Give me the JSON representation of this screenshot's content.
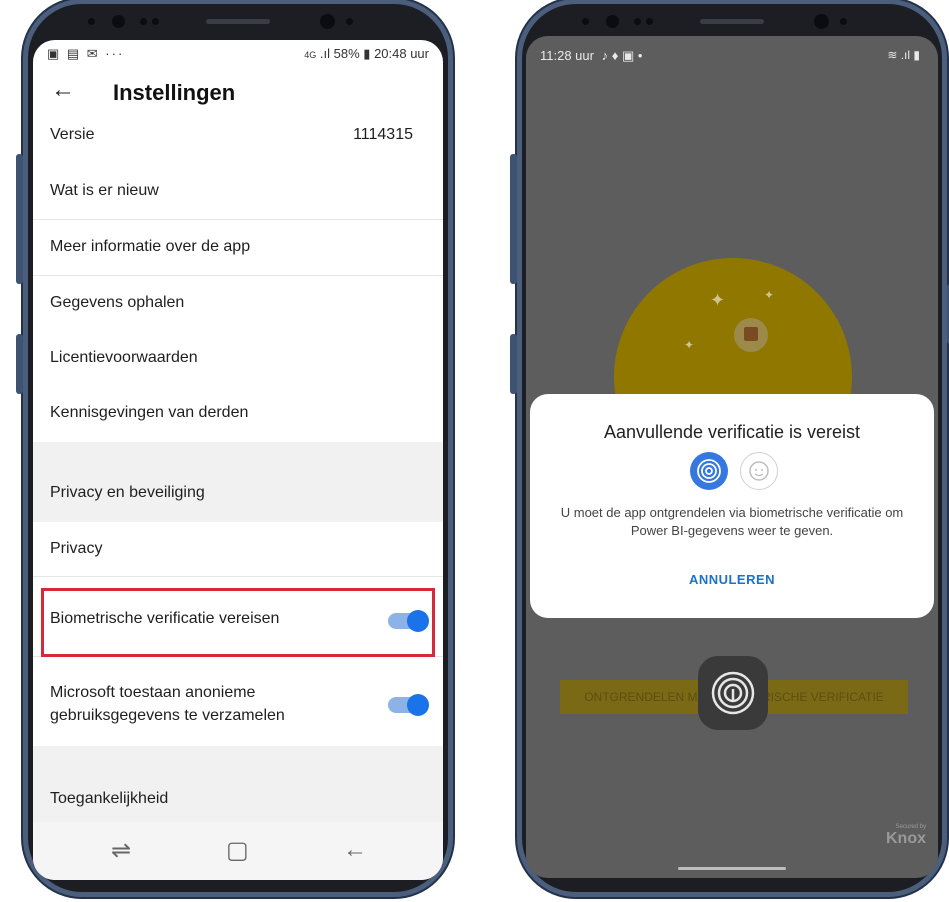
{
  "left_phone": {
    "status_bar": {
      "left_icons": [
        "image-icon",
        "calendar-icon",
        "mail-icon",
        "more-icon"
      ],
      "network": "4G",
      "battery": "58%",
      "time": "20:48 uur"
    },
    "app_bar": {
      "title": "Instellingen"
    },
    "rows": [
      {
        "label": "Versie",
        "value": "1114315"
      },
      {
        "label": "Wat is er nieuw"
      },
      {
        "label": "Meer informatie over de app"
      },
      {
        "label": "Gegevens ophalen"
      },
      {
        "label": "Licentievoorwaarden"
      },
      {
        "label": "Kennisgevingen van derden"
      }
    ],
    "section_privacy": "Privacy en beveiliging",
    "privacy_row": "Privacy",
    "biometric_toggle": {
      "label": "Biometrische verificatie vereisen",
      "on": true
    },
    "telemetry_toggle": {
      "label_line1": "Microsoft toestaan anonieme",
      "label_line2": "gebruiksgegevens te verzamelen",
      "on": true
    },
    "section_accessibility": "Toegankelijkheid",
    "accent_color": "#1a73e8",
    "highlight_color": "#d62a3b"
  },
  "right_phone": {
    "status_bar": {
      "time": "11:28 uur"
    },
    "dialog": {
      "title": "Aanvullende verificatie is vereist",
      "message": "U moet de app ontgrendelen via biometrische verificatie om Power BI-gegevens weer te geven.",
      "cancel": "ANNULEREN"
    },
    "unlock_button": "ONTGRENDELEN MET BIOMETRISCHE VERIFICATIE",
    "knox_small": "Secured by",
    "knox_logo": "Knox"
  }
}
